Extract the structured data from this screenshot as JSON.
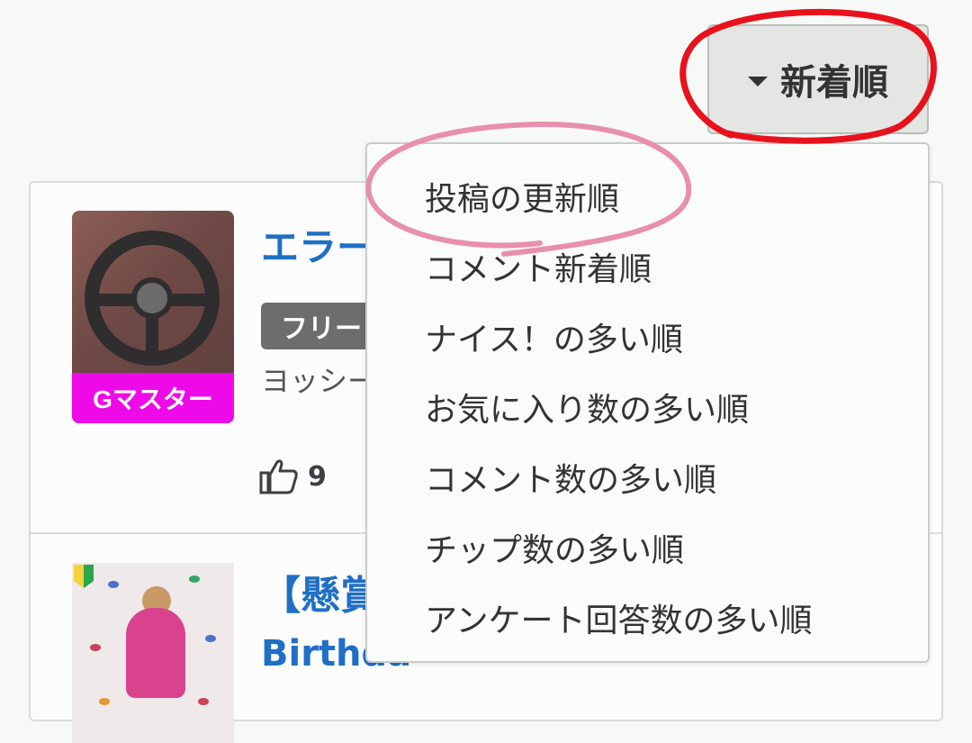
{
  "sort_button": {
    "label": "新着順"
  },
  "sort_menu": {
    "items": [
      "投稿の更新順",
      "コメント新着順",
      "ナイス！の多い順",
      "お気に入り数の多い順",
      "コメント数の多い順",
      "チップ数の多い順",
      "アンケート回答数の多い順"
    ]
  },
  "posts": [
    {
      "title_visible": "エラー",
      "tag": "フリー",
      "author_visible": "ヨッシー",
      "user_badge": "Gマスター",
      "likes": "9"
    },
    {
      "title_line1_visible": "【懸賞",
      "title_line2_visible": "Birthda"
    }
  ],
  "colors": {
    "accent_link": "#1f6fc4",
    "badge_gmaster": "#ee0ae8",
    "annotation_red": "#e8121c",
    "annotation_pink": "#e88fad"
  },
  "icons": [
    "caret-down-icon",
    "thumbs-up-icon",
    "beginner-mark-icon"
  ]
}
